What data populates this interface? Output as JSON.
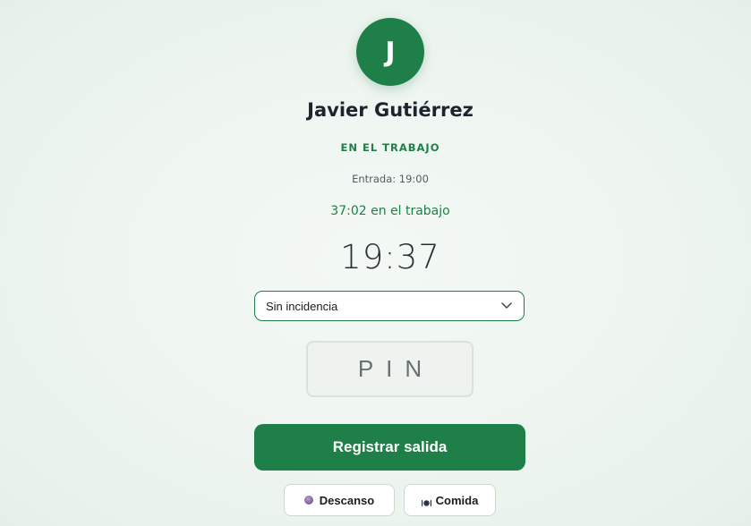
{
  "employee": {
    "initial": "J",
    "name": "Javier Gutiérrez",
    "status": "EN EL TRABAJO",
    "entry": "Entrada: 19:00",
    "elapsed": "37:02 en el trabajo"
  },
  "clock": {
    "time": "19:37"
  },
  "incident_select": {
    "selected": "Sin incidencia",
    "icon": "chevron-down-icon"
  },
  "pin": {
    "placeholder": "PIN"
  },
  "actions": {
    "primary_label": "Registrar salida",
    "break_label": "Descanso",
    "break_icon": "break-icon",
    "meal_label": "Comida",
    "meal_icon": "meal-icon"
  },
  "colors": {
    "accent": "#1e7f49",
    "background": "#eef5f0",
    "text": "#1c2430"
  }
}
